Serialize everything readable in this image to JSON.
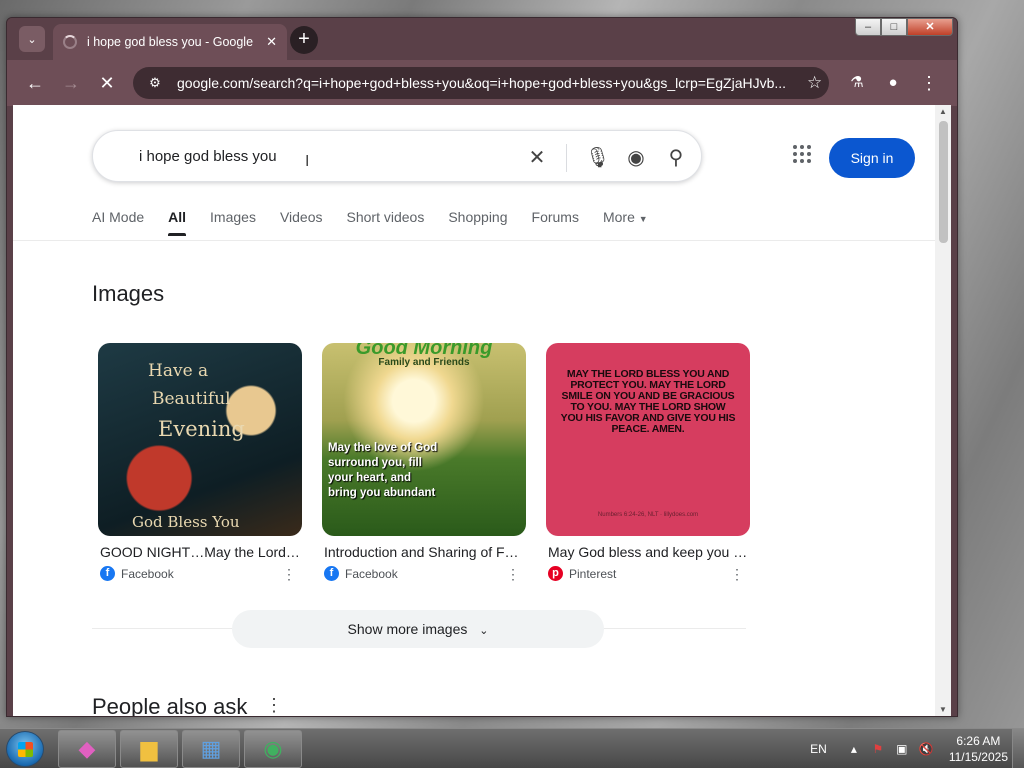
{
  "browser": {
    "tab": {
      "title": "i hope god bless you - Google"
    },
    "url": "google.com/search?q=i+hope+god+bless+you&oq=i+hope+god+bless+you&gs_lcrp=EgZjaHJvb..."
  },
  "search": {
    "query": "i hope god bless you",
    "sign_in_label": "Sign in"
  },
  "tabs": [
    {
      "label": "AI Mode"
    },
    {
      "label": "All"
    },
    {
      "label": "Images"
    },
    {
      "label": "Videos"
    },
    {
      "label": "Short videos"
    },
    {
      "label": "Shopping"
    },
    {
      "label": "Forums"
    },
    {
      "label": "More"
    }
  ],
  "images_section": {
    "title": "Images",
    "cards": [
      {
        "title": "GOOD NIGHT…May the Lord…",
        "source": "Facebook",
        "image_text": {
          "l1": "Have a",
          "l2": "Beautiful",
          "l3": "Evening",
          "l4": "God Bless You"
        }
      },
      {
        "title": "Introduction and Sharing of F…",
        "source": "Facebook",
        "image_text": {
          "header": "Good Morning",
          "sub": "Family and Friends",
          "poem": "May the love of God surround you, fill your heart, and bring you abundant"
        }
      },
      {
        "title": "May God bless and keep you …",
        "source": "Pinterest",
        "image_text": {
          "verse": "MAY THE LORD BLESS YOU AND PROTECT YOU. MAY THE LORD SMILE ON YOU AND BE GRACIOUS TO YOU. MAY THE LORD SHOW YOU HIS FAVOR AND GIVE YOU HIS PEACE. AMEN.",
          "ref": "Numbers 6:24-26, NLT · lillydoes.com"
        }
      }
    ],
    "show_more_label": "Show more images"
  },
  "people_also_ask": {
    "title": "People also ask"
  },
  "taskbar": {
    "language": "EN",
    "time": "6:26 AM",
    "date": "11/15/2025"
  },
  "colors": {
    "browser_frame": "#5a4048",
    "sign_in": "#0b57d0"
  }
}
